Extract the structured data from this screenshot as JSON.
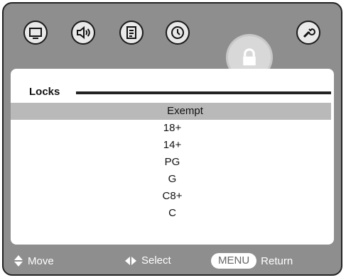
{
  "icons": [
    {
      "name": "tv-icon",
      "active": false
    },
    {
      "name": "sound-icon",
      "active": false
    },
    {
      "name": "document-icon",
      "active": false
    },
    {
      "name": "clock-icon",
      "active": false
    },
    {
      "name": "lock-icon",
      "active": true
    },
    {
      "name": "wrench-icon",
      "active": false
    }
  ],
  "panel": {
    "title": "Locks",
    "items": [
      "Exempt",
      "18+",
      "14+",
      "PG",
      "G",
      "C8+",
      "C"
    ],
    "selected_index": 0
  },
  "footer": {
    "move_label": "Move",
    "select_label": "Select",
    "menu_label": "MENU",
    "return_label": "Return"
  }
}
